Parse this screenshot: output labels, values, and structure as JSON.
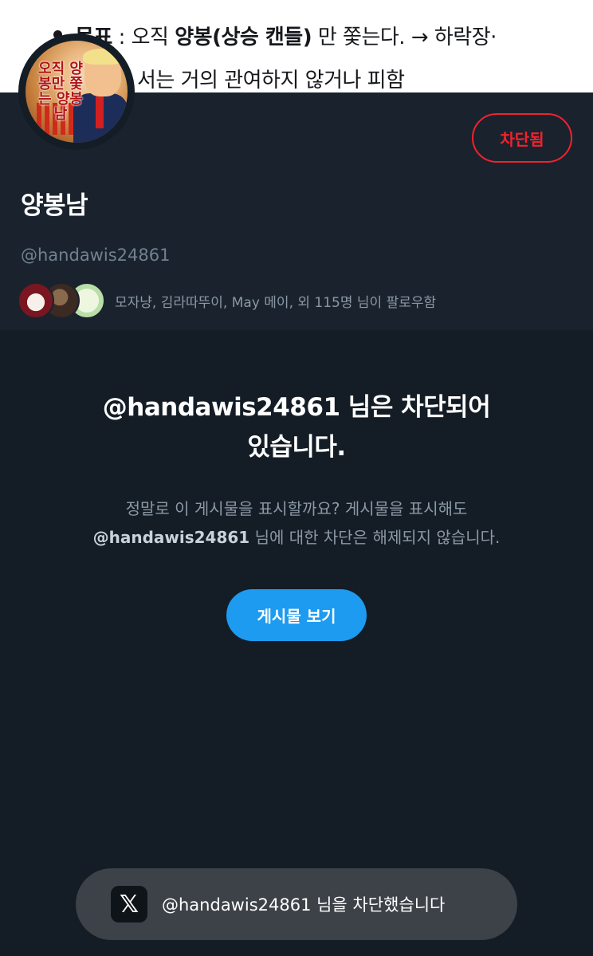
{
  "banner": {
    "line1_prefix": "목표",
    "line1_mid": " : 오직 ",
    "line1_bold": "양봉(상승 캔들)",
    "line1_suffix": " 만 쫓는다. → 하락장·",
    "line2": "서는 거의 관여하지 않거나 피함"
  },
  "profile": {
    "avatar_text": "오직 양봉만 쫓는 양봉남",
    "blocked_label": "차단됨",
    "display_name": "양봉남",
    "handle": "@handawis24861",
    "followers_text": "모자냥, 김라따뚜이, May 메이, 외 115명 님이 팔로우함"
  },
  "blocked": {
    "title_line1": "@handawis24861 님은 차단되어",
    "title_line2": "있습니다.",
    "desc_line1": "정말로 이 게시물을 표시할까요? 게시물을 표시해도",
    "desc_handle": "@handawis24861",
    "desc_line2_rest": " 님에 대한 차단은 해제되지 않습니다.",
    "view_button": "게시물 보기"
  },
  "toast": {
    "icon": "x-logo-icon",
    "logo_glyph": "𝕏",
    "message": "@handawis24861 님을 차단했습니다"
  },
  "colors": {
    "background": "#141d26",
    "header": "#1a232d",
    "accent_blue": "#1d9bf0",
    "danger_red": "#f4212e",
    "muted_text": "#8b98a5"
  }
}
